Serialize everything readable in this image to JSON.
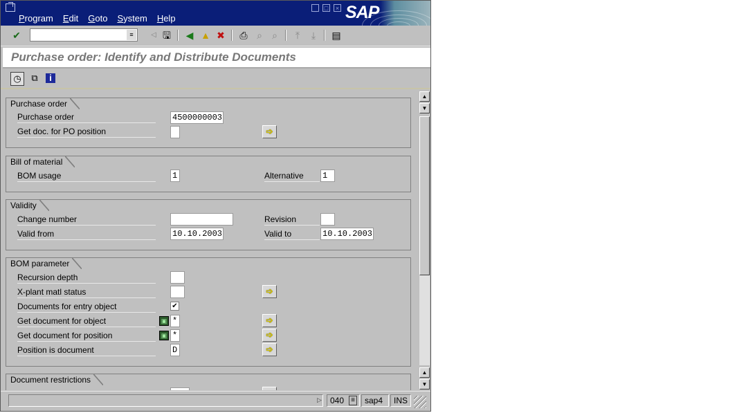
{
  "window": {
    "menu": [
      "Program",
      "Edit",
      "Goto",
      "System",
      "Help"
    ],
    "menu_underline": [
      "P",
      "E",
      "G",
      "S",
      "H"
    ],
    "logo": "SAP"
  },
  "toolbar": {
    "command_field_value": "",
    "icons": [
      "enter-check-icon",
      "command-dropdown-icon",
      "back-triangle-icon",
      "save-icon",
      "back-icon",
      "exit-icon",
      "cancel-icon",
      "print-icon",
      "find-icon",
      "find-next-icon",
      "first-page-icon",
      "last-page-icon",
      "create-session-icon"
    ]
  },
  "page": {
    "title": "Purchase order: Identify and Distribute Documents",
    "app_icons": [
      "execute-clock-icon",
      "copy-icon",
      "info-icon"
    ]
  },
  "purchase_order": {
    "title": "Purchase order",
    "po_label": "Purchase order",
    "po_value": "4500000003",
    "pos_label": "Get doc. for PO position",
    "pos_value": ""
  },
  "bom": {
    "title": "Bill of material",
    "usage_label": "BOM usage",
    "usage_value": "1",
    "alt_label": "Alternative",
    "alt_value": "1"
  },
  "validity": {
    "title": "Validity",
    "change_label": "Change number",
    "change_value": "",
    "revision_label": "Revision",
    "revision_value": "",
    "from_label": "Valid from",
    "from_value": "10.10.2003",
    "to_label": "Valid to",
    "to_value": "10.10.2003"
  },
  "bom_param": {
    "title": "BOM parameter",
    "recursion_label": "Recursion depth",
    "recursion_value": "",
    "xplant_label": "X-plant matl status",
    "xplant_value": "",
    "docs_entry_label": "Documents for entry object",
    "docs_entry_checked": true,
    "get_obj_label": "Get document for object",
    "get_obj_value": "*",
    "get_pos_label": "Get document for position",
    "get_pos_value": "*",
    "pos_is_doc_label": "Position is document",
    "pos_is_doc_value": "D"
  },
  "doc_restrictions": {
    "title": "Document restrictions"
  },
  "statusbar": {
    "client": "040",
    "server": "sap4",
    "mode": "INS"
  }
}
